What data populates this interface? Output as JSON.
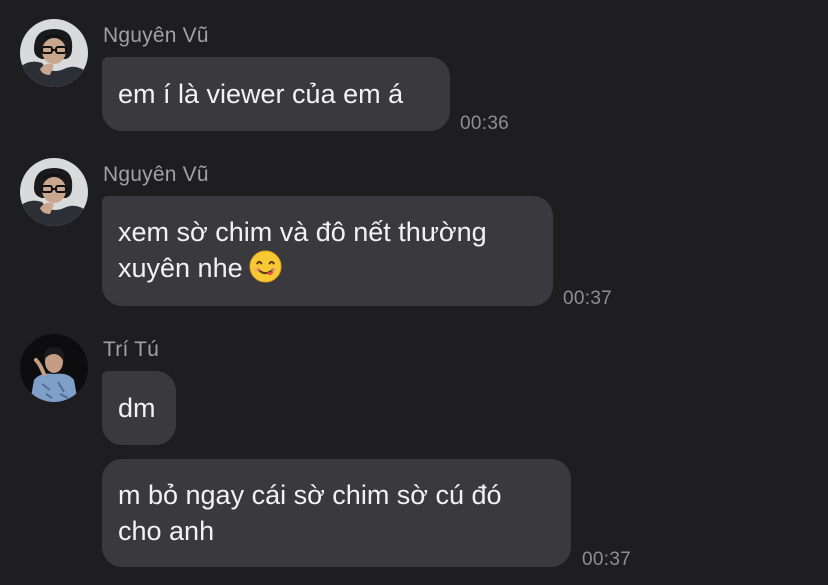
{
  "messages": [
    {
      "sender": "Nguyên Vũ",
      "lines": [
        "em í là viewer của em á"
      ],
      "time": "00:36",
      "avatar_icon": "avatar-nguyen-vu-icon"
    },
    {
      "sender": "Nguyên Vũ",
      "lines": [
        "xem sờ chim và đô nết thường",
        "xuyên nhe"
      ],
      "time": "00:37",
      "emoji_icon": "yum-face-emoji",
      "avatar_icon": "avatar-nguyen-vu-icon"
    },
    {
      "sender": "Trí Tú",
      "lines": [
        "dm"
      ],
      "avatar_icon": "avatar-tri-tu-icon"
    },
    {
      "lines": [
        "m bỏ ngay cái sờ chim sờ cú đó",
        "cho anh"
      ],
      "time": "00:37"
    }
  ],
  "colors": {
    "background": "#1e1e21",
    "bubble": "#3a3a3e",
    "bubble_text": "#f2f2f4",
    "sender_text": "#a0a0a6",
    "time_text": "#8e8e93"
  }
}
